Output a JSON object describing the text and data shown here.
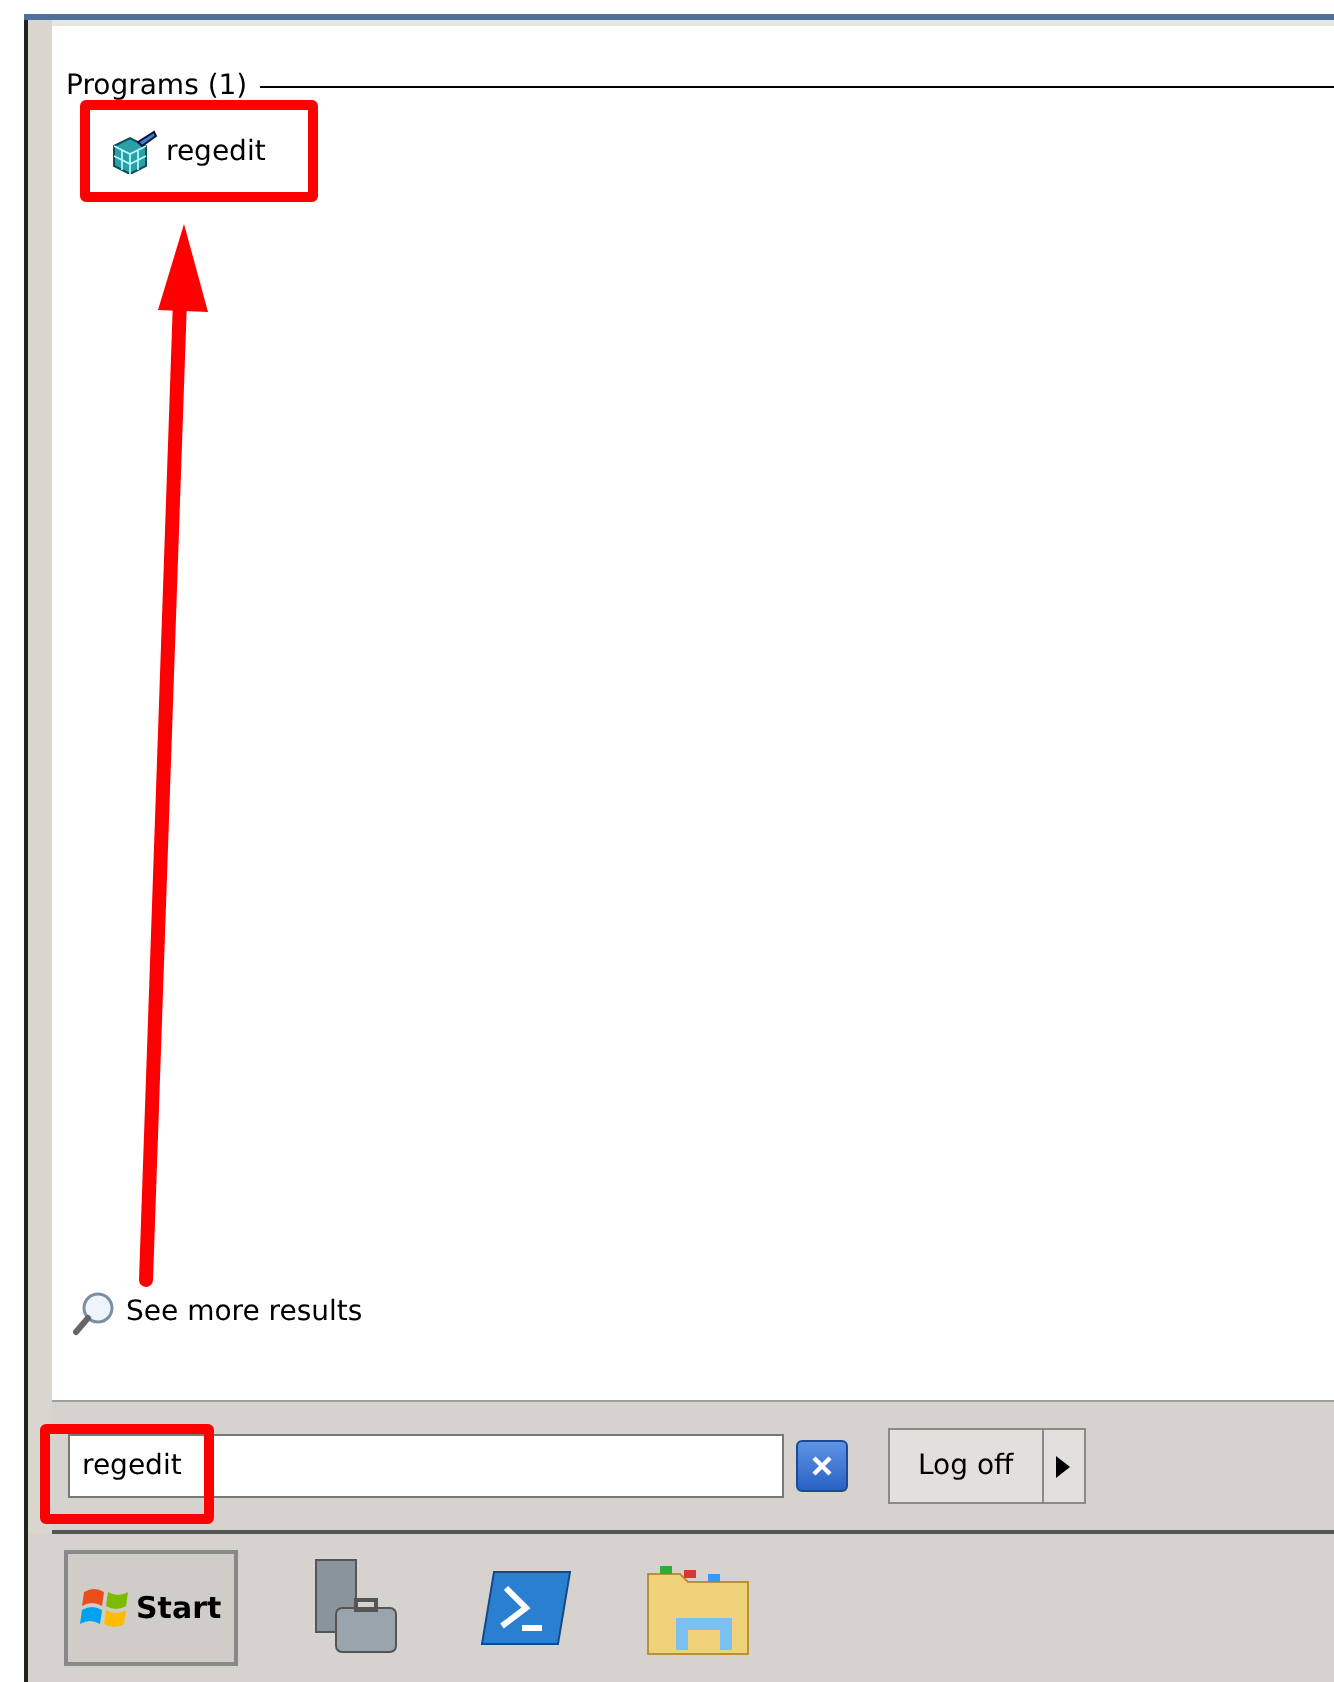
{
  "search_results": {
    "group_heading": "Programs (1)",
    "items": [
      {
        "label": "regedit"
      }
    ],
    "see_more": "See more results"
  },
  "search_box": {
    "value": "regedit"
  },
  "power_button": {
    "label": "Log off"
  },
  "taskbar": {
    "start_label": "Start"
  }
}
